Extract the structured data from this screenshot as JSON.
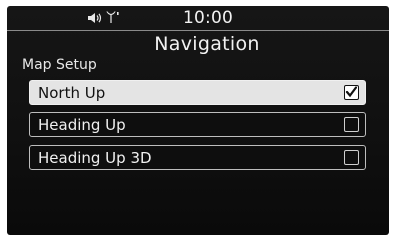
{
  "status": {
    "time": "10:00",
    "icons": [
      "speaker-volume-icon",
      "antenna-signal-icon"
    ]
  },
  "header": {
    "title": "Navigation"
  },
  "section": {
    "label": "Map Setup"
  },
  "options": [
    {
      "label": "North Up",
      "checked": true
    },
    {
      "label": "Heading Up",
      "checked": false
    },
    {
      "label": "Heading Up 3D",
      "checked": false
    }
  ],
  "colors": {
    "background": "#111111",
    "selected_row": "#e4e4e4",
    "text": "#f0f0f0",
    "border": "#bdbdbd"
  }
}
